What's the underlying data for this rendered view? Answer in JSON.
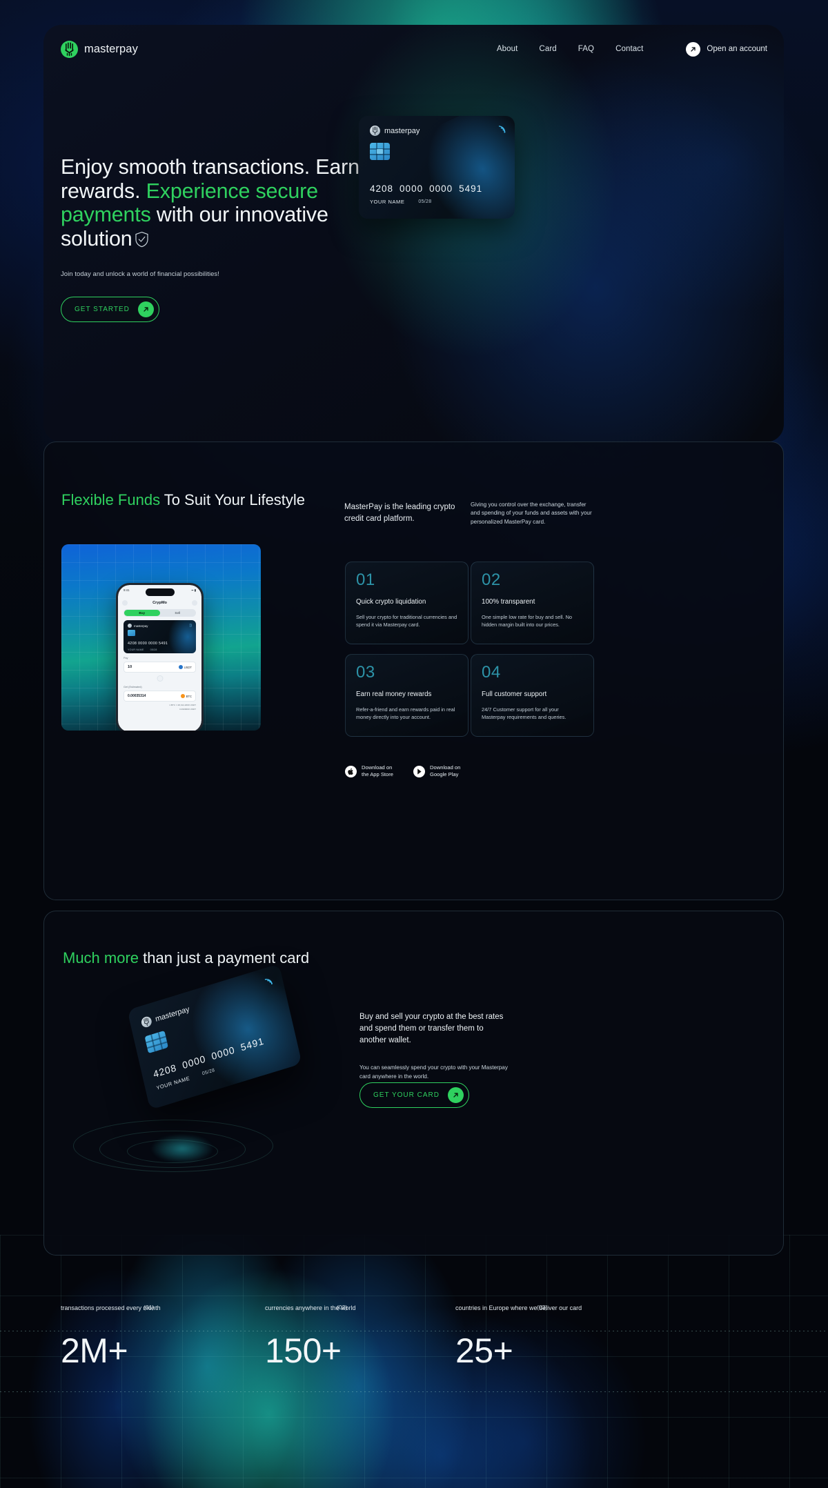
{
  "brand": {
    "name": "masterpay",
    "logo_icon": "masterpay-logo-icon",
    "accent_green": "#2fd15f",
    "accent_teal": "#2d93a8"
  },
  "header": {
    "nav": [
      {
        "label": "About"
      },
      {
        "label": "Card"
      },
      {
        "label": "FAQ"
      },
      {
        "label": "Contact"
      }
    ],
    "cta": {
      "label": "Open an account",
      "icon": "arrow-up-right-icon"
    }
  },
  "hero": {
    "title_part1": "Enjoy smooth transactions. Earn rewards. ",
    "title_accent": "Experience secure payments",
    "title_part2": " with our innovative solution",
    "shield_icon": "shield-check-icon",
    "subtitle": "Join today and unlock a world of financial possibilities!",
    "cta": {
      "label": "GET STARTED",
      "icon": "arrow-up-right-icon"
    },
    "card": {
      "brand": "masterpay",
      "number_groups": [
        "4208",
        "0000",
        "0000",
        "5491"
      ],
      "holder": "YOUR NAME",
      "expiry": "05/28",
      "contactless_icon": "contactless-icon",
      "chip_icon": "emv-chip-icon"
    }
  },
  "flexible": {
    "title_accent": "Flexible Funds",
    "title_rest": " To Suit Your Lifestyle",
    "lead": "MasterPay is the leading crypto credit card platform.",
    "note": "Giving you control over the exchange, transfer and spending of your funds and assets with your personalized MasterPay card.",
    "features": [
      {
        "num": "01",
        "title": "Quick crypto liquidation",
        "desc": "Sell your crypto for traditional currencies and spend it via Masterpay card."
      },
      {
        "num": "02",
        "title": "100% transparent",
        "desc": "One simple low rate for buy and sell. No hidden margin built into our prices."
      },
      {
        "num": "03",
        "title": "Earn real money rewards",
        "desc": "Refer-a-friend and earn rewards paid in real money directly into your account."
      },
      {
        "num": "04",
        "title": "Full customer support",
        "desc": "24/7 Customer support for all your Masterpay requirements and queries."
      }
    ],
    "stores": [
      {
        "line1": "Download on",
        "line2": "the App Store",
        "icon": "apple-icon"
      },
      {
        "line1": "Download on",
        "line2": "Google Play",
        "icon": "google-play-icon"
      }
    ],
    "phone": {
      "status_time": "9:41",
      "app_title": "CrypMo",
      "tab_buy": "Buy",
      "tab_sell": "Sell",
      "card_brand": "masterpay",
      "card_number": "4208  0000  0000  5491",
      "card_holder": "YOUR NAME",
      "card_expiry": "05/28",
      "pay_label": "Pay",
      "pay_amount": "10",
      "pay_currency": "USDT",
      "max_label": "Max",
      "get_label": "Get (Estimated)",
      "get_amount": "0.00035314",
      "get_currency": "BTC",
      "rate_line": "1 BTC = 28,314.2000 USDT",
      "fee_line": "0.4900000 USDT"
    }
  },
  "much": {
    "title_accent": "Much more",
    "title_rest": " than just a payment card",
    "lead": "Buy and sell your crypto at the best rates and spend them or transfer them to another wallet.",
    "note": "You can seamlessly spend your crypto with your Masterpay card anywhere in the world.",
    "cta": {
      "label": "GET YOUR CARD",
      "icon": "arrow-up-right-icon"
    },
    "card": {
      "brand": "masterpay",
      "number_groups": [
        "4208",
        "0000",
        "0000",
        "5491"
      ],
      "holder": "YOUR NAME",
      "expiry": "05/28",
      "contactless_icon": "contactless-icon"
    }
  },
  "stats": [
    {
      "label": "transactions processed every month",
      "index": "(01)",
      "value": "2M+"
    },
    {
      "label": "currencies anywhere in the world",
      "index": "(02)",
      "value": "150+"
    },
    {
      "label": "countries in Europe where we deliver our card",
      "index": "(03)",
      "value": "25+"
    }
  ]
}
